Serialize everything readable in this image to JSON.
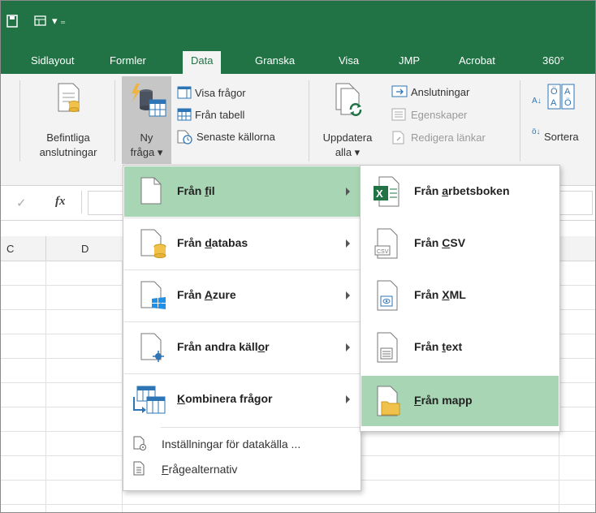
{
  "colors": {
    "brand": "#217346",
    "highlight": "#a8d5b4",
    "ribbon": "#f3f3f3"
  },
  "quick_access": {
    "customize_glyph": "▾ ₌"
  },
  "tabs": [
    "Sidlayout",
    "Formler",
    "Data",
    "Granska",
    "Visa",
    "JMP",
    "Acrobat",
    "360°"
  ],
  "active_tab": "Data",
  "ribbon": {
    "existing_line1": "Befintliga",
    "existing_line2": "anslutningar",
    "new_query_line1": "Ny",
    "new_query_line2": "fråga ▾",
    "show_queries": "Visa frågor",
    "from_table": "Från tabell",
    "recent_sources": "Senaste källorna",
    "refresh_line1": "Uppdatera",
    "refresh_line2": "alla ▾",
    "connections": "Anslutningar",
    "properties": "Egenskaper",
    "edit_links": "Redigera länkar",
    "sort": "Sortera",
    "sort_az_small": "A↓",
    "sort_za_small": "ö↓"
  },
  "formula_bar": {
    "fx": "fx",
    "check": "✓"
  },
  "columns": {
    "c": "C",
    "d": "D"
  },
  "menu": {
    "items": [
      {
        "label_pre": "Från ",
        "key": "f",
        "label_post": "il"
      },
      {
        "label_pre": "Från ",
        "key": "d",
        "label_post": "atabas"
      },
      {
        "label_pre": "Från ",
        "key": "A",
        "label_post": "zure"
      },
      {
        "label_pre": "Från andra käll",
        "key": "o",
        "label_post": "r"
      },
      {
        "label_pre": "",
        "key": "K",
        "label_post": "ombinera frågor"
      }
    ],
    "settings": "Inställningar för datakälla ...",
    "options_key": "F",
    "options_rest": "rågealternativ"
  },
  "submenu": {
    "items": [
      {
        "label_pre": "Från ",
        "key": "a",
        "label_post": "rbetsboken"
      },
      {
        "label_pre": "Från ",
        "key": "C",
        "label_post": "SV"
      },
      {
        "label_pre": "Från ",
        "key": "X",
        "label_post": "ML"
      },
      {
        "label_pre": "Från ",
        "key": "t",
        "label_post": "ext"
      },
      {
        "label_pre": "",
        "key": "F",
        "label_post": "rån mapp"
      }
    ],
    "csv_tag": "CSV"
  }
}
